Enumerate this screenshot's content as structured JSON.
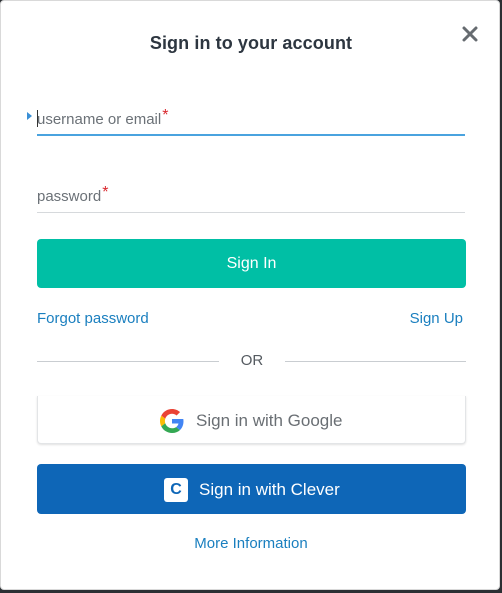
{
  "dialog": {
    "title": "Sign in to your account",
    "close_icon": "close-icon"
  },
  "form": {
    "username": {
      "placeholder": "username or email",
      "required_mark": "*",
      "value": ""
    },
    "password": {
      "placeholder": "password",
      "required_mark": "*",
      "value": ""
    },
    "signin_label": "Sign In"
  },
  "links": {
    "forgot_password": "Forgot password",
    "sign_up": "Sign Up"
  },
  "divider": {
    "text": "OR"
  },
  "sso": {
    "google": {
      "label": "Sign in with Google",
      "icon": "google-logo-icon"
    },
    "clever": {
      "label": "Sign in with Clever",
      "icon": "clever-logo-icon",
      "icon_letter": "C"
    }
  },
  "footer": {
    "more_info": "More Information"
  },
  "colors": {
    "primary": "#00bfa5",
    "clever": "#0e66b7",
    "link": "#1a7fbf",
    "required": "#d8262c",
    "focus_underline": "#4aa3df"
  }
}
